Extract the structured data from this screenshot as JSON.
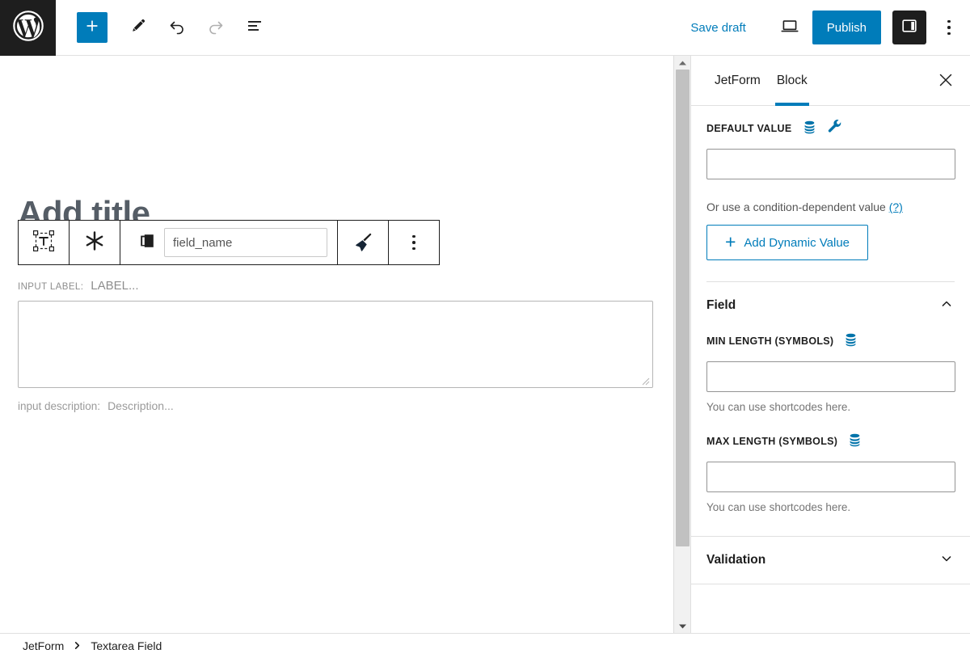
{
  "topbar": {
    "logo_icon": "wordpress-logo-icon",
    "add_block_label": "+",
    "add_block_icon": "plus-icon",
    "edit_tool_icon": "pencil-icon",
    "undo_icon": "undo-arrow-icon",
    "redo_icon": "redo-arrow-icon",
    "list_view_icon": "document-outline-icon",
    "save_draft_label": "Save draft",
    "preview_icon": "laptop-preview-icon",
    "publish_label": "Publish",
    "sidebar_toggle_icon": "settings-panel-icon",
    "options_icon": "kebab-menu-icon"
  },
  "editor": {
    "title_placeholder": "Add title",
    "block_toolbar": {
      "block_type_icon": "textarea-block-icon",
      "transform_icon": "asterisk-icon",
      "duplicate_icon": "copy-pages-icon",
      "field_name_value": "field_name",
      "field_name_placeholder": "field_name",
      "style_icon": "paintbrush-icon",
      "more_options_icon": "kebab-menu-icon"
    },
    "field_preview": {
      "label_prefix": "INPUT LABEL:",
      "label_value": "LABEL...",
      "textarea_value": "",
      "resize_handle_icon": "resize-grip-icon",
      "description_prefix": "input description:",
      "description_value": "Description..."
    },
    "scrollbar": {
      "up_arrow_icon": "caret-up-icon",
      "down_arrow_icon": "caret-down-icon"
    }
  },
  "sidebar": {
    "tabs": [
      {
        "label": "JetForm",
        "active": false
      },
      {
        "label": "Block",
        "active": true
      }
    ],
    "close_icon": "close-x-icon",
    "default_value": {
      "label": "DEFAULT VALUE",
      "macros_icon": "database-macros-icon",
      "tools_icon": "wrench-tools-icon",
      "value": "",
      "condition_text": "Or use a condition-dependent value",
      "condition_help_label": "(?)",
      "add_dynamic_label": "Add Dynamic Value",
      "add_dynamic_plus_icon": "plus-icon"
    },
    "field_panel": {
      "title": "Field",
      "chevron_icon": "chevron-up-icon",
      "min_length": {
        "label": "MIN LENGTH (SYMBOLS)",
        "macros_icon": "database-macros-icon",
        "value": "",
        "help": "You can use shortcodes here."
      },
      "max_length": {
        "label": "MAX LENGTH (SYMBOLS)",
        "macros_icon": "database-macros-icon",
        "value": "",
        "help": "You can use shortcodes here."
      }
    },
    "validation_panel": {
      "title": "Validation",
      "chevron_icon": "chevron-down-icon"
    }
  },
  "footer": {
    "breadcrumbs": [
      "JetForm",
      "Textarea Field"
    ],
    "separator_icon": "chevron-right-icon"
  },
  "colors": {
    "accent": "#007cba",
    "dark": "#1e1e1e",
    "muted": "#757575",
    "border": "#e0e0e0"
  }
}
